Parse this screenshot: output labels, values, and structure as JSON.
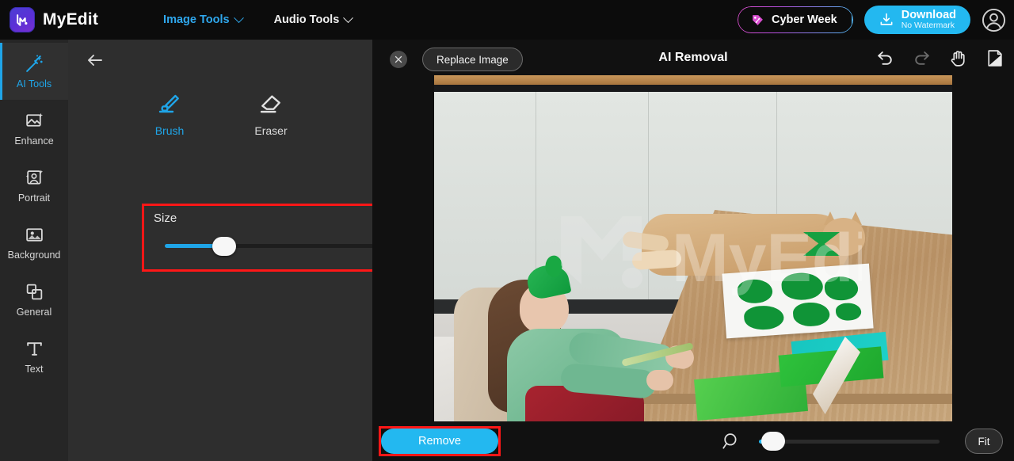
{
  "header": {
    "brand": "MyEdit",
    "logo_icon": "myedit-logo-icon",
    "nav": [
      {
        "label": "Image Tools",
        "icon": "chevron-down-icon",
        "active": true
      },
      {
        "label": "Audio Tools",
        "icon": "chevron-down-icon",
        "active": false
      }
    ],
    "cyber_week": {
      "label": "Cyber Week",
      "icon": "price-tag-icon"
    },
    "download": {
      "label": "Download",
      "sub_label": "No Watermark",
      "icon": "download-icon"
    },
    "account_icon": "user-avatar-icon"
  },
  "sidebar": {
    "items": [
      {
        "label": "AI Tools",
        "icon": "magic-wand-icon",
        "active": true
      },
      {
        "label": "Enhance",
        "icon": "image-sparkle-icon",
        "active": false
      },
      {
        "label": "Portrait",
        "icon": "person-portrait-icon",
        "active": false
      },
      {
        "label": "Background",
        "icon": "image-background-icon",
        "active": false
      },
      {
        "label": "General",
        "icon": "shapes-layers-icon",
        "active": false
      },
      {
        "label": "Text",
        "icon": "text-t-icon",
        "active": false
      }
    ]
  },
  "panel": {
    "back_icon": "arrow-left-icon",
    "modes": [
      {
        "label": "Brush",
        "icon": "brush-icon",
        "active": true
      },
      {
        "label": "Eraser",
        "icon": "eraser-icon",
        "active": false
      }
    ],
    "size": {
      "label": "Size",
      "value": "29",
      "min": "1",
      "max": "100",
      "fill_percent": 28
    },
    "collapse_icon": "chevron-left-icon",
    "highlight_color": "#ff1717"
  },
  "stage": {
    "close_icon": "close-x-icon",
    "replace_button": "Replace Image",
    "title": "AI Removal",
    "tools": [
      {
        "name": "undo-icon",
        "state": "enabled"
      },
      {
        "name": "redo-icon",
        "state": "disabled"
      },
      {
        "name": "hand-pan-icon",
        "state": "enabled"
      },
      {
        "name": "compare-split-icon",
        "state": "enabled"
      }
    ],
    "watermark": "MyEdit",
    "image_description": "Girl in green top with green headband crafting paper shamrocks at a wooden table beside a ginger cat wearing a green bow tie in a white kitchen"
  },
  "bottom": {
    "remove_button": "Remove",
    "zoom_icon": "magnifier-icon",
    "zoom_percent": 6,
    "fit_button": "Fit",
    "highlight_color": "#ff1717"
  },
  "colors": {
    "accent_blue": "#23b8f0",
    "active_cyan": "#1fa5e8",
    "highlight_red": "#ff1717",
    "panel_bg": "#2e2e2e",
    "rail_bg": "#262626",
    "app_bg": "#111111"
  }
}
